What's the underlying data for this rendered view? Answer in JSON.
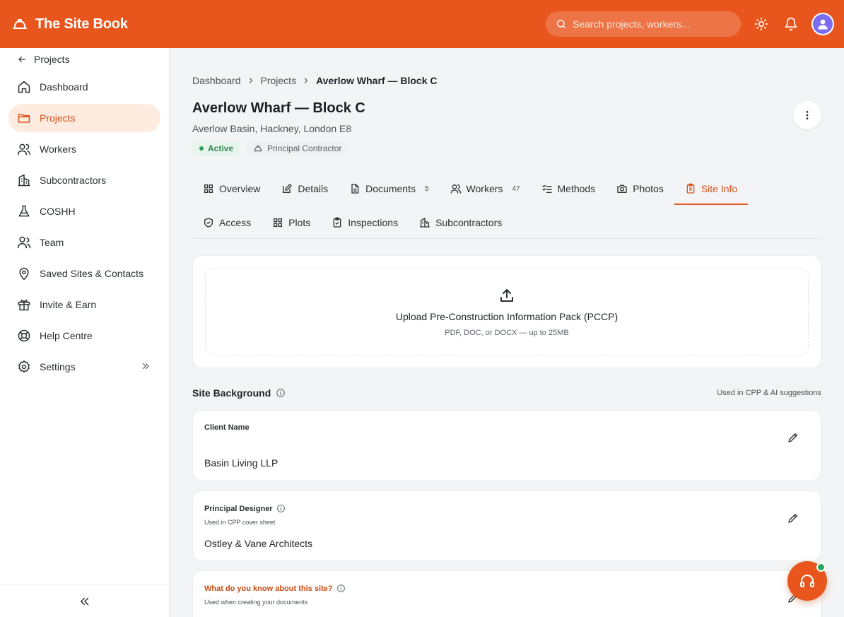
{
  "app": {
    "name": "The Site Book"
  },
  "header": {
    "search_placeholder": "Search projects, workers..."
  },
  "sidebar": {
    "back_label": "Projects",
    "items": [
      {
        "label": "Dashboard",
        "icon": "home-icon"
      },
      {
        "label": "Projects",
        "icon": "folder-icon",
        "active": true
      },
      {
        "label": "Workers",
        "icon": "users-icon"
      },
      {
        "label": "Subcontractors",
        "icon": "building-icon"
      },
      {
        "label": "COSHH",
        "icon": "flask-icon"
      },
      {
        "label": "Team",
        "icon": "team-icon"
      },
      {
        "label": "Saved Sites & Contacts",
        "icon": "map-pin-icon"
      },
      {
        "label": "Invite & Earn",
        "icon": "gift-icon"
      },
      {
        "label": "Help Centre",
        "icon": "lifebuoy-icon"
      },
      {
        "label": "Settings",
        "icon": "gear-icon"
      }
    ]
  },
  "breadcrumb": {
    "items": [
      "Dashboard",
      "Projects",
      "Averlow Wharf — Block C"
    ]
  },
  "project": {
    "title": "Averlow Wharf — Block C",
    "address": "Averlow Basin, Hackney, London E8",
    "status": "Active",
    "role": "Principal Contractor"
  },
  "tabs": {
    "row1": [
      {
        "label": "Overview",
        "icon": "grid-icon"
      },
      {
        "label": "Details",
        "icon": "edit-icon"
      },
      {
        "label": "Documents",
        "icon": "document-icon",
        "count": "5"
      },
      {
        "label": "Workers",
        "icon": "users-icon",
        "count": "47"
      },
      {
        "label": "Methods",
        "icon": "checklist-icon"
      },
      {
        "label": "Photos",
        "icon": "camera-icon"
      },
      {
        "label": "Site Info",
        "icon": "clipboard-icon",
        "active": true
      }
    ],
    "row2": [
      {
        "label": "Access",
        "icon": "shield-icon"
      },
      {
        "label": "Plots",
        "icon": "grid-icon"
      },
      {
        "label": "Inspections",
        "icon": "clipboard-check-icon"
      },
      {
        "label": "Subcontractors",
        "icon": "building-icon"
      }
    ]
  },
  "upload": {
    "title": "Upload Pre-Construction Information Pack (PCCP)",
    "subtitle": "PDF, DOC, or DOCX — up to 25MB"
  },
  "site_background": {
    "title": "Site Background",
    "note": "Used in CPP & AI suggestions",
    "fields": [
      {
        "label": "Client Name",
        "sub": "",
        "value": "Basin Living LLP"
      },
      {
        "label": "Principal Designer",
        "sub": "Used in CPP cover sheet",
        "value": "Ostley & Vane Architects"
      },
      {
        "label": "What do you know about this site?",
        "sub": "Used when creating your documents",
        "value": ""
      }
    ]
  },
  "colors": {
    "brand": "#e8561e",
    "active_bg": "#fdebe0",
    "status_green": "#2f8a50"
  }
}
